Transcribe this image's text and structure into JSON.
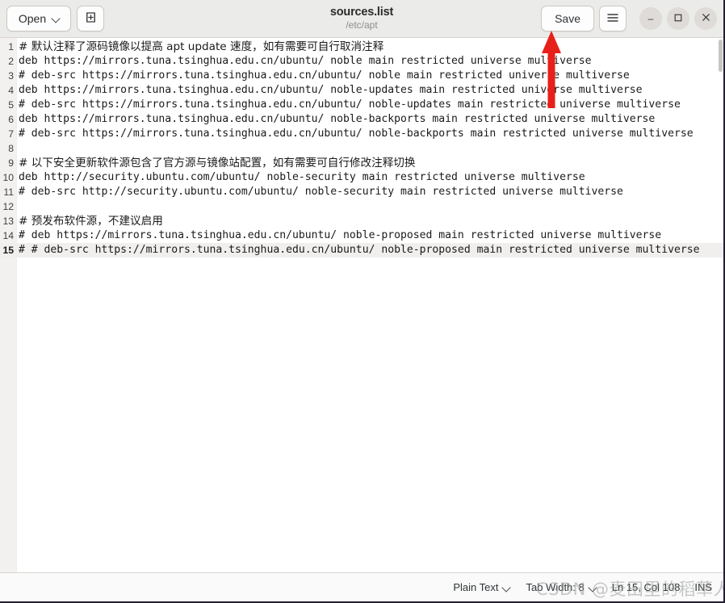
{
  "window": {
    "title": "sources.list",
    "subtitle": "/etc/apt"
  },
  "headerbar": {
    "open_label": "Open",
    "open_chevron_icon": "chevron-down-icon",
    "new_document_icon": "new-document-icon",
    "save_label": "Save",
    "menu_icon": "hamburger-menu-icon",
    "minimize_icon": "minimize-icon",
    "maximize_icon": "maximize-icon",
    "close_icon": "close-icon",
    "minimize_glyph": "–",
    "maximize_glyph": "☐",
    "close_glyph": "×"
  },
  "editor": {
    "current_line": 15,
    "lines": [
      {
        "n": "1",
        "text": "# 默认注释了源码镜像以提高 apt update 速度，如有需要可自行取消注释",
        "cjk": true
      },
      {
        "n": "2",
        "text": "deb https://mirrors.tuna.tsinghua.edu.cn/ubuntu/ noble main restricted universe multiverse",
        "cjk": false
      },
      {
        "n": "3",
        "text": "# deb-src https://mirrors.tuna.tsinghua.edu.cn/ubuntu/ noble main restricted universe multiverse",
        "cjk": false
      },
      {
        "n": "4",
        "text": "deb https://mirrors.tuna.tsinghua.edu.cn/ubuntu/ noble-updates main restricted universe multiverse",
        "cjk": false
      },
      {
        "n": "5",
        "text": "# deb-src https://mirrors.tuna.tsinghua.edu.cn/ubuntu/ noble-updates main restricted universe multiverse",
        "cjk": false
      },
      {
        "n": "6",
        "text": "deb https://mirrors.tuna.tsinghua.edu.cn/ubuntu/ noble-backports main restricted universe multiverse",
        "cjk": false
      },
      {
        "n": "7",
        "text": "# deb-src https://mirrors.tuna.tsinghua.edu.cn/ubuntu/ noble-backports main restricted universe multiverse",
        "cjk": false
      },
      {
        "n": "8",
        "text": "",
        "cjk": false
      },
      {
        "n": "9",
        "text": "# 以下安全更新软件源包含了官方源与镜像站配置，如有需要可自行修改注释切换",
        "cjk": true
      },
      {
        "n": "10",
        "text": "deb http://security.ubuntu.com/ubuntu/ noble-security main restricted universe multiverse",
        "cjk": false
      },
      {
        "n": "11",
        "text": "# deb-src http://security.ubuntu.com/ubuntu/ noble-security main restricted universe multiverse",
        "cjk": false
      },
      {
        "n": "12",
        "text": "",
        "cjk": false
      },
      {
        "n": "13",
        "text": "# 预发布软件源，不建议启用",
        "cjk": true
      },
      {
        "n": "14",
        "text": "# deb https://mirrors.tuna.tsinghua.edu.cn/ubuntu/ noble-proposed main restricted universe multiverse",
        "cjk": false
      },
      {
        "n": "15",
        "text": "# # deb-src https://mirrors.tuna.tsinghua.edu.cn/ubuntu/ noble-proposed main restricted universe multiverse",
        "cjk": false
      }
    ]
  },
  "statusbar": {
    "syntax_label": "Plain Text",
    "syntax_chevron_icon": "chevron-down-icon",
    "tab_width_label": "Tab Width: 8",
    "tab_chevron_icon": "chevron-down-icon",
    "position_label": "Ln 15, Col 108",
    "insert_mode_label": "INS"
  },
  "annotations": {
    "arrow_color": "#e8201a",
    "arrow_target": "save-button",
    "watermark_text": "CSDN @麦田里的稻草人"
  }
}
